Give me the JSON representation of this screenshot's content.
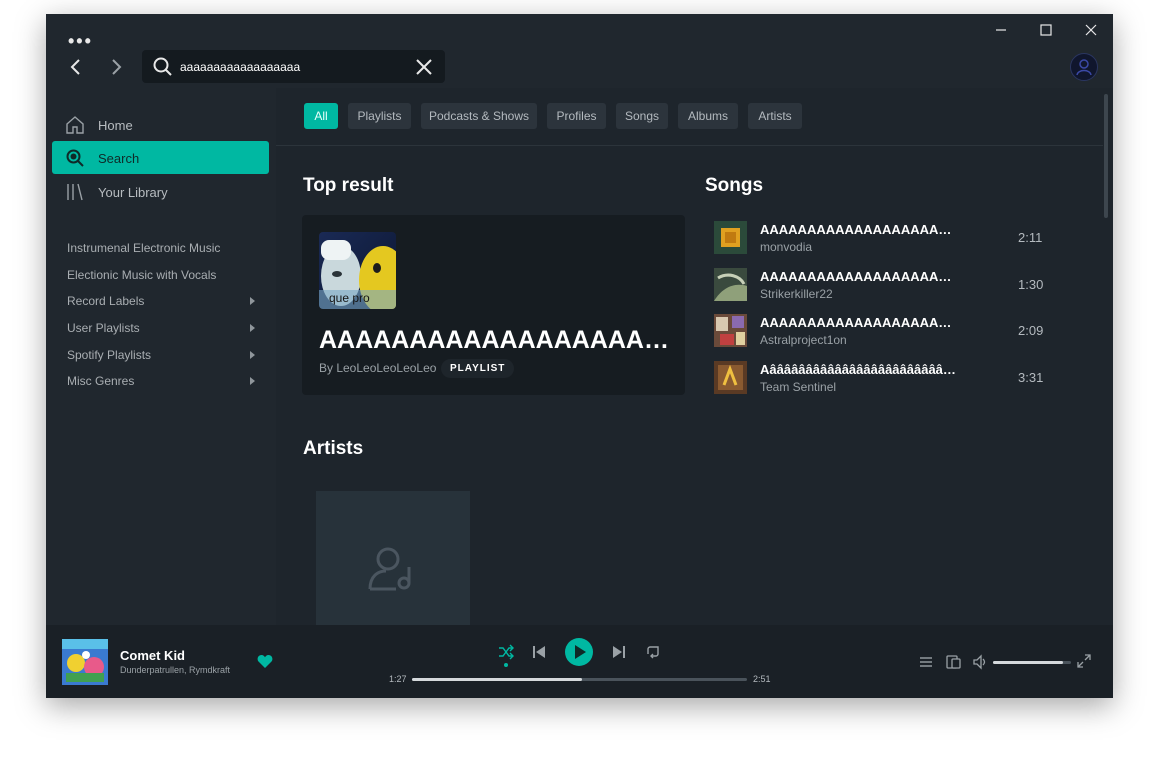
{
  "search": {
    "value": "aaaaaaaaaaaaaaaaaa"
  },
  "sidebar": {
    "nav": [
      {
        "label": "Home",
        "icon": "home-icon"
      },
      {
        "label": "Search",
        "icon": "search-icon"
      },
      {
        "label": "Your Library",
        "icon": "library-icon"
      }
    ],
    "playlists": [
      {
        "label": "Instrumenal Electronic Music"
      },
      {
        "label": "Electionic Music with Vocals"
      },
      {
        "label": "Record Labels"
      },
      {
        "label": "User Playlists"
      },
      {
        "label": "Spotify Playlists"
      },
      {
        "label": "Misc Genres"
      }
    ]
  },
  "filters": [
    "All",
    "Playlists",
    "Podcasts & Shows",
    "Profiles",
    "Songs",
    "Albums",
    "Artists"
  ],
  "sections": {
    "top_result": "Top result",
    "songs": "Songs",
    "artists": "Artists"
  },
  "top_result": {
    "title": "AAAAAAAAAAAAAAAAAAAAAAAAAAAAAAA",
    "by": "By LeoLeoLeoLeoLeo",
    "type": "PLAYLIST",
    "art_caption": "que pro"
  },
  "songs": [
    {
      "title": "AAAAAAAAAAAAAAAAAAAAAAAAAAAAAA",
      "artist": "monvodia",
      "duration": "2:11"
    },
    {
      "title": "AAAAAAAAAAAAAAAAAAAAAAAAAAAAAA",
      "artist": "Strikerkiller22",
      "duration": "1:30"
    },
    {
      "title": "AAAAAAAAAAAAAAAAAAAAAAAAAAAAAA",
      "artist": "Astralproject1on",
      "duration": "2:09"
    },
    {
      "title": "Aâââââââââââââââââââââââââââââ",
      "artist": "Team Sentinel",
      "duration": "3:31"
    }
  ],
  "now_playing": {
    "title": "Comet Kid",
    "artist": "Dunderpatrullen, Rymdkraft",
    "elapsed": "1:27",
    "total": "2:51",
    "progress": 0.508,
    "volume": 0.9
  },
  "colors": {
    "accent": "#00b8a2",
    "background": "#1e252c",
    "sidebar": "#20272e"
  }
}
